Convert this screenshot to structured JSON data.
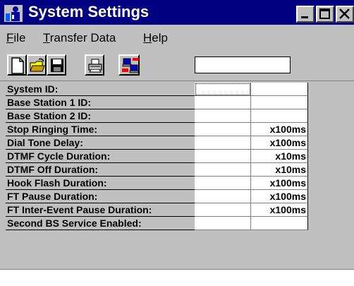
{
  "window": {
    "title": "System Settings"
  },
  "menu": [
    {
      "label": "File",
      "u": "F",
      "rest": "ile"
    },
    {
      "label": "Transfer Data",
      "u": "T",
      "rest": "ransfer Data"
    },
    {
      "label": "Help",
      "u": "H",
      "rest": "elp"
    }
  ],
  "toolbar": {
    "buttons": [
      "new-file-icon",
      "open-folder-icon",
      "save-disk-icon",
      "print-icon",
      "transfer-computers-icon"
    ],
    "input_value": ""
  },
  "settings": {
    "rows": [
      {
        "label": "System ID:",
        "value": "",
        "unit": ""
      },
      {
        "label": "Base Station 1 ID:",
        "value": "",
        "unit": ""
      },
      {
        "label": "Base Station 2 ID:",
        "value": "",
        "unit": ""
      },
      {
        "label": "Stop Ringing Time:",
        "value": "",
        "unit": "x100ms"
      },
      {
        "label": "Dial Tone Delay:",
        "value": "",
        "unit": "x100ms"
      },
      {
        "label": "DTMF Cycle Duration:",
        "value": "",
        "unit": "x10ms"
      },
      {
        "label": "DTMF Off Duration:",
        "value": "",
        "unit": "x10ms"
      },
      {
        "label": "Hook Flash Duration:",
        "value": "",
        "unit": "x100ms"
      },
      {
        "label": "FT Pause Duration:",
        "value": "",
        "unit": "x100ms"
      },
      {
        "label": "FT Inter-Event Pause Duration:",
        "value": "",
        "unit": "x100ms"
      },
      {
        "label": "Second BS Service Enabled:",
        "value": "",
        "unit": ""
      }
    ]
  },
  "colors": {
    "titlebar": "#000080",
    "face": "#c0c0c0",
    "field": "#ffffff"
  }
}
